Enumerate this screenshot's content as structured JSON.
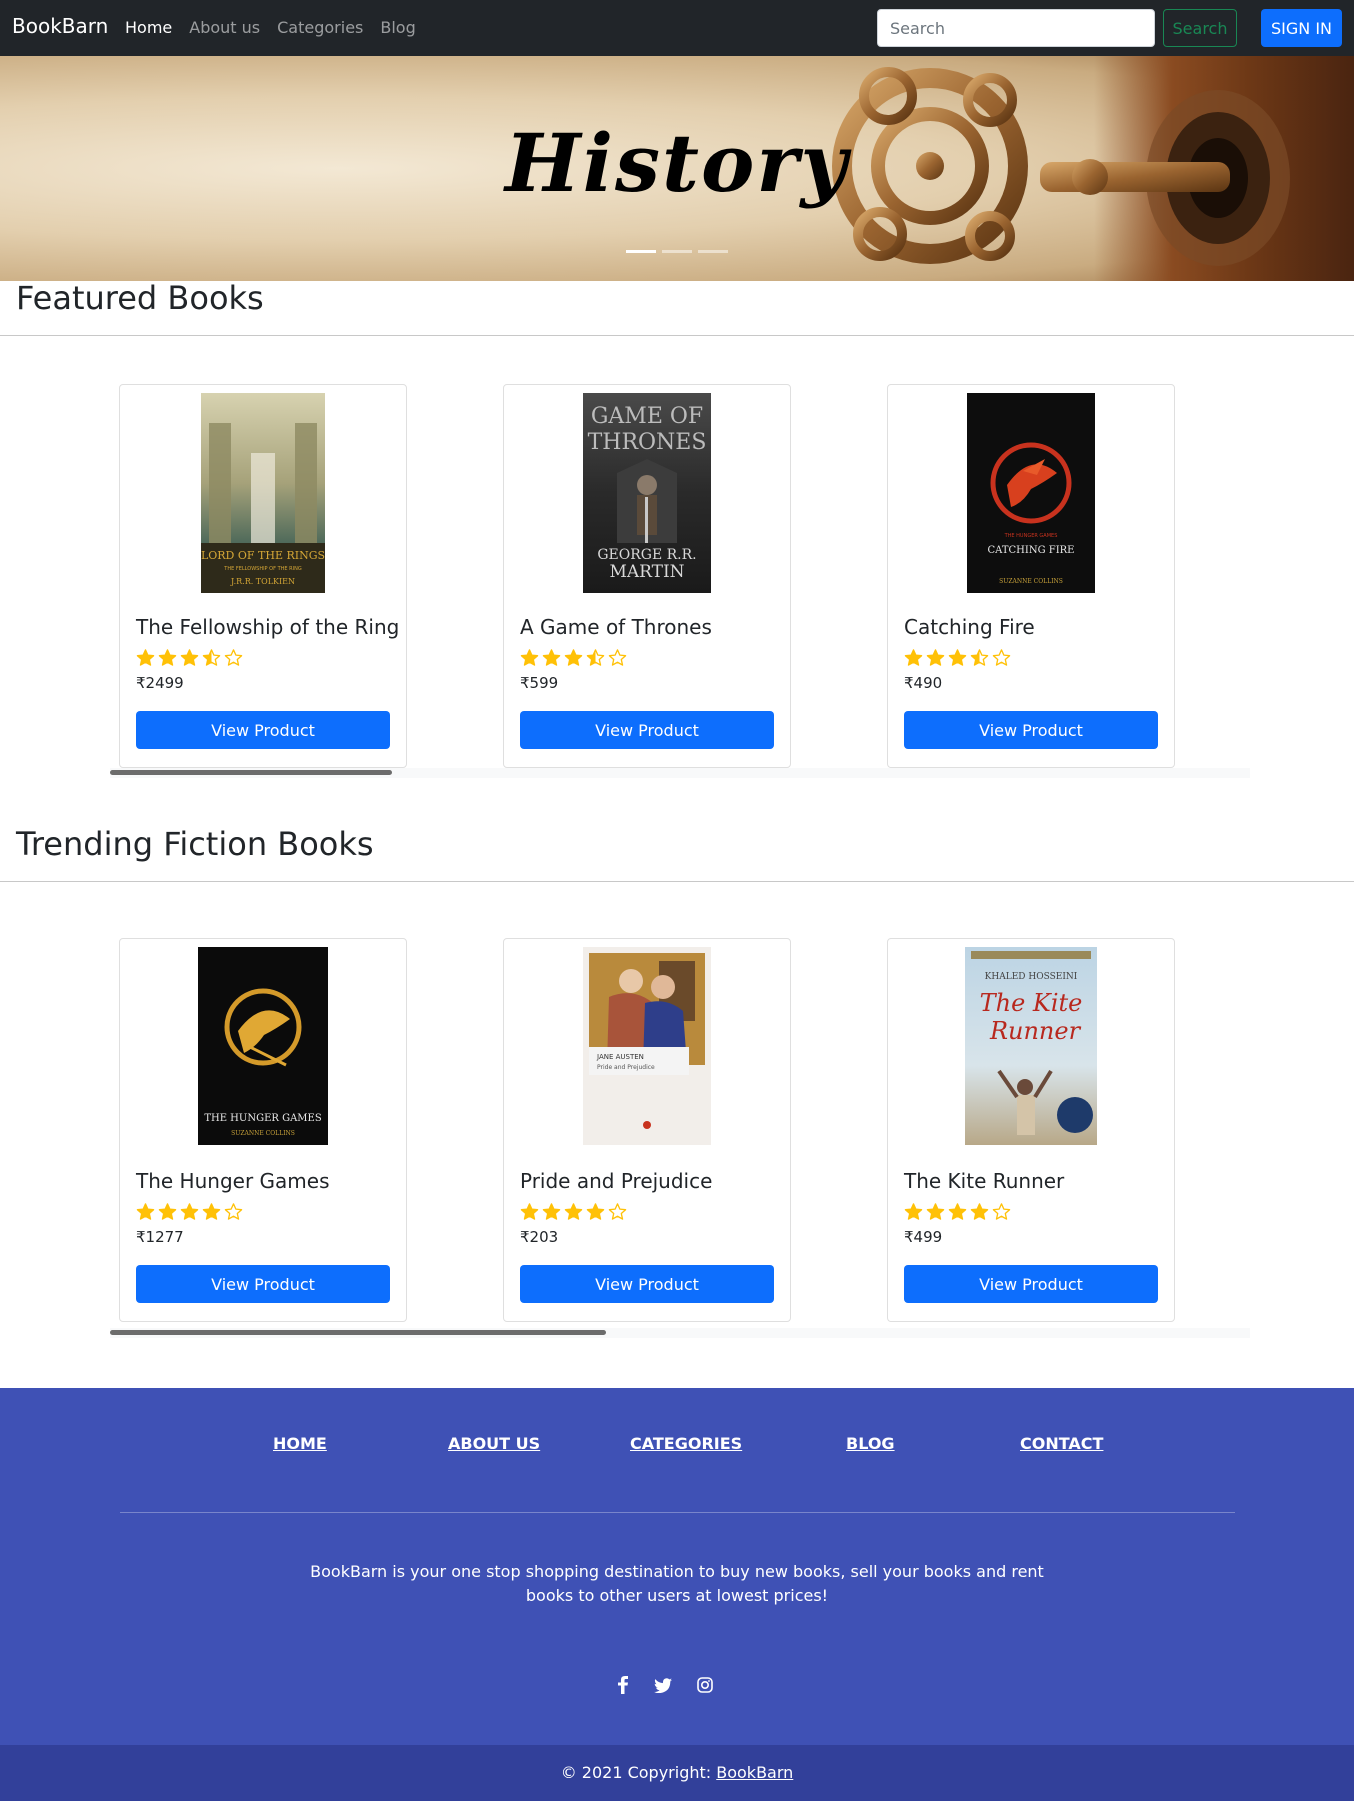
{
  "navbar": {
    "brand": "BookBarn",
    "links": [
      {
        "label": "Home",
        "active": true
      },
      {
        "label": "About us"
      },
      {
        "label": "Categories"
      },
      {
        "label": "Blog"
      }
    ],
    "search": {
      "placeholder": "Search",
      "value": ""
    },
    "search_button": "Search",
    "signin_button": "SIGN IN"
  },
  "hero": {
    "title": "History",
    "slide_count": 3,
    "active_slide": 1
  },
  "featured": {
    "title": "Featured Books",
    "books": [
      {
        "title": "The Fellowship of the Ring",
        "rating": 3.5,
        "price": "₹2499",
        "button": "View Product",
        "cover_text": [
          "LORD OF THE RINGS",
          "THE FELLOWSHIP OF THE RING",
          "J.R.R. TOLKIEN"
        ]
      },
      {
        "title": "A Game of Thrones",
        "rating": 3.5,
        "price": "₹599",
        "button": "View Product",
        "cover_text": [
          "GAME OF",
          "THRONES",
          "GEORGE R.R.",
          "MARTIN"
        ]
      },
      {
        "title": "Catching Fire",
        "rating": 3.5,
        "price": "₹490",
        "button": "View Product",
        "cover_text": [
          "THE HUNGER GAMES",
          "CATCHING FIRE",
          "SUZANNE COLLINS"
        ]
      }
    ]
  },
  "trending": {
    "title": "Trending Fiction Books",
    "books": [
      {
        "title": "The Hunger Games",
        "rating": 4,
        "price": "₹1277",
        "button": "View Product",
        "cover_text": [
          "THE HUNGER GAMES",
          "SUZANNE COLLINS"
        ]
      },
      {
        "title": "Pride and Prejudice",
        "rating": 4,
        "price": "₹203",
        "button": "View Product",
        "cover_text": [
          "JANE AUSTEN",
          "Pride and Prejudice"
        ]
      },
      {
        "title": "The Kite Runner",
        "rating": 4,
        "price": "₹499",
        "button": "View Product",
        "cover_text": [
          "KHALED HOSSEINI",
          "The Kite",
          "Runner"
        ]
      }
    ]
  },
  "footer": {
    "links": [
      "HOME",
      "ABOUT US",
      "CATEGORIES",
      "BLOG",
      "CONTACT"
    ],
    "description": "BookBarn is your one stop shopping destination to buy new books, sell your books and rent books to other users at lowest prices!",
    "social_icons": [
      "facebook-icon",
      "twitter-icon",
      "instagram-icon"
    ],
    "copyright_prefix": "© 2021 Copyright: ",
    "copyright_link": "BookBarn"
  },
  "colors": {
    "navbar": "#212529",
    "primary": "#0d6efd",
    "success": "#198754",
    "footer": "#3f51b5",
    "footer_bottom": "#32409a",
    "star": "#ffc107"
  }
}
